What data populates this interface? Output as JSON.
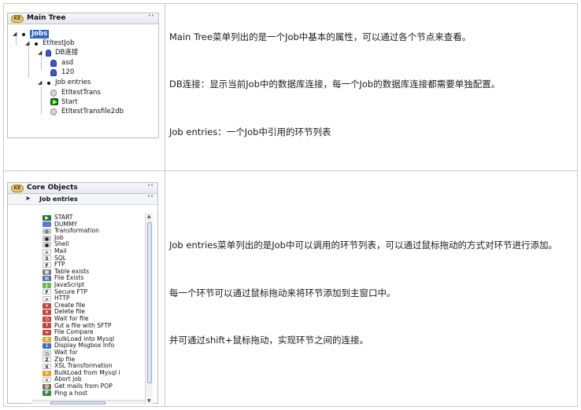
{
  "main_tree": {
    "title": "Main Tree",
    "logo": "KE",
    "nodes": {
      "jobs": "Jobs",
      "job": "EtltestJob",
      "db": "DB连接",
      "asd": "asd",
      "n120": "120",
      "entries": "Job entries",
      "trans": "EtltestTrans",
      "start": "Start",
      "trans2": "EtltestTransfile2db"
    }
  },
  "core_objects": {
    "title": "Core Objects",
    "logo": "KE",
    "category": "Job entries",
    "entries": [
      {
        "label": "START",
        "color": "#0c7f19",
        "glyph": "▶"
      },
      {
        "label": "DUMMY",
        "color": "#5a78e0",
        "glyph": ""
      },
      {
        "label": "Transformation",
        "color": "#c9c9c9",
        "glyph": "⚙"
      },
      {
        "label": "Job",
        "color": "#c9c9c9",
        "glyph": "●"
      },
      {
        "label": "Shell",
        "color": "#d9d9d9",
        "glyph": "●"
      },
      {
        "label": "Mail",
        "color": "#ffffff",
        "glyph": ">"
      },
      {
        "label": "SQL",
        "color": "#ffffff",
        "glyph": "S"
      },
      {
        "label": "FTP",
        "color": "#ffffff",
        "glyph": "F"
      },
      {
        "label": "Table exists",
        "color": "#7a7a7a",
        "glyph": "▦"
      },
      {
        "label": "File Exists",
        "color": "#4a6fb5",
        "glyph": "▤"
      },
      {
        "label": "JavaScript",
        "color": "#6bb64a",
        "glyph": "J"
      },
      {
        "label": "Secure FTP",
        "color": "#ffffff",
        "glyph": "F"
      },
      {
        "label": "HTTP",
        "color": "#ffffff",
        "glyph": ">"
      },
      {
        "label": "Create file",
        "color": "#c4433b",
        "glyph": "+"
      },
      {
        "label": "Delete file",
        "color": "#c4433b",
        "glyph": "×"
      },
      {
        "label": "Wait for file",
        "color": "#c4433b",
        "glyph": "◷"
      },
      {
        "label": "Put a file with SFTP",
        "color": "#c4433b",
        "glyph": "↑"
      },
      {
        "label": "File Compare",
        "color": "#c4433b",
        "glyph": "="
      },
      {
        "label": "BulkLoad into Mysql",
        "color": "#e3a12f",
        "glyph": "⚙"
      },
      {
        "label": "Display Msgbox Info",
        "color": "#3a6fc4",
        "glyph": "i"
      },
      {
        "label": "Wait for",
        "color": "#e8e8e8",
        "glyph": "◷"
      },
      {
        "label": "Zip file",
        "color": "#ffffff",
        "glyph": "Z"
      },
      {
        "label": "XSL Transformation",
        "color": "#ffffff",
        "glyph": "X"
      },
      {
        "label": "BulkLoad from Mysql i",
        "color": "#e3a12f",
        "glyph": "⚙"
      },
      {
        "label": "Abort job",
        "color": "#ffffff",
        "glyph": "✕"
      },
      {
        "label": "Get mails from POP",
        "color": "#7b6a4f",
        "glyph": "@"
      },
      {
        "label": "Ping a host",
        "color": "#2a8a3a",
        "glyph": "P"
      }
    ]
  },
  "descriptions": {
    "row1": [
      "Main Tree菜单列出的是一个Job中基本的属性，可以通过各个节点来查看。",
      "DB连接：显示当前Job中的数据库连接，每一个Job的数据库连接都需要单独配置。",
      "Job entries：一个Job中引用的环节列表"
    ],
    "row2": [
      "Job entries菜单列出的是Job中可以调用的环节列表，可以通过鼠标拖动的方式对环节进行添加。",
      "每一个环节可以通过鼠标拖动来将环节添加到主窗口中。",
      "并可通过shift+鼠标拖动，实现环节之间的连接。"
    ]
  }
}
